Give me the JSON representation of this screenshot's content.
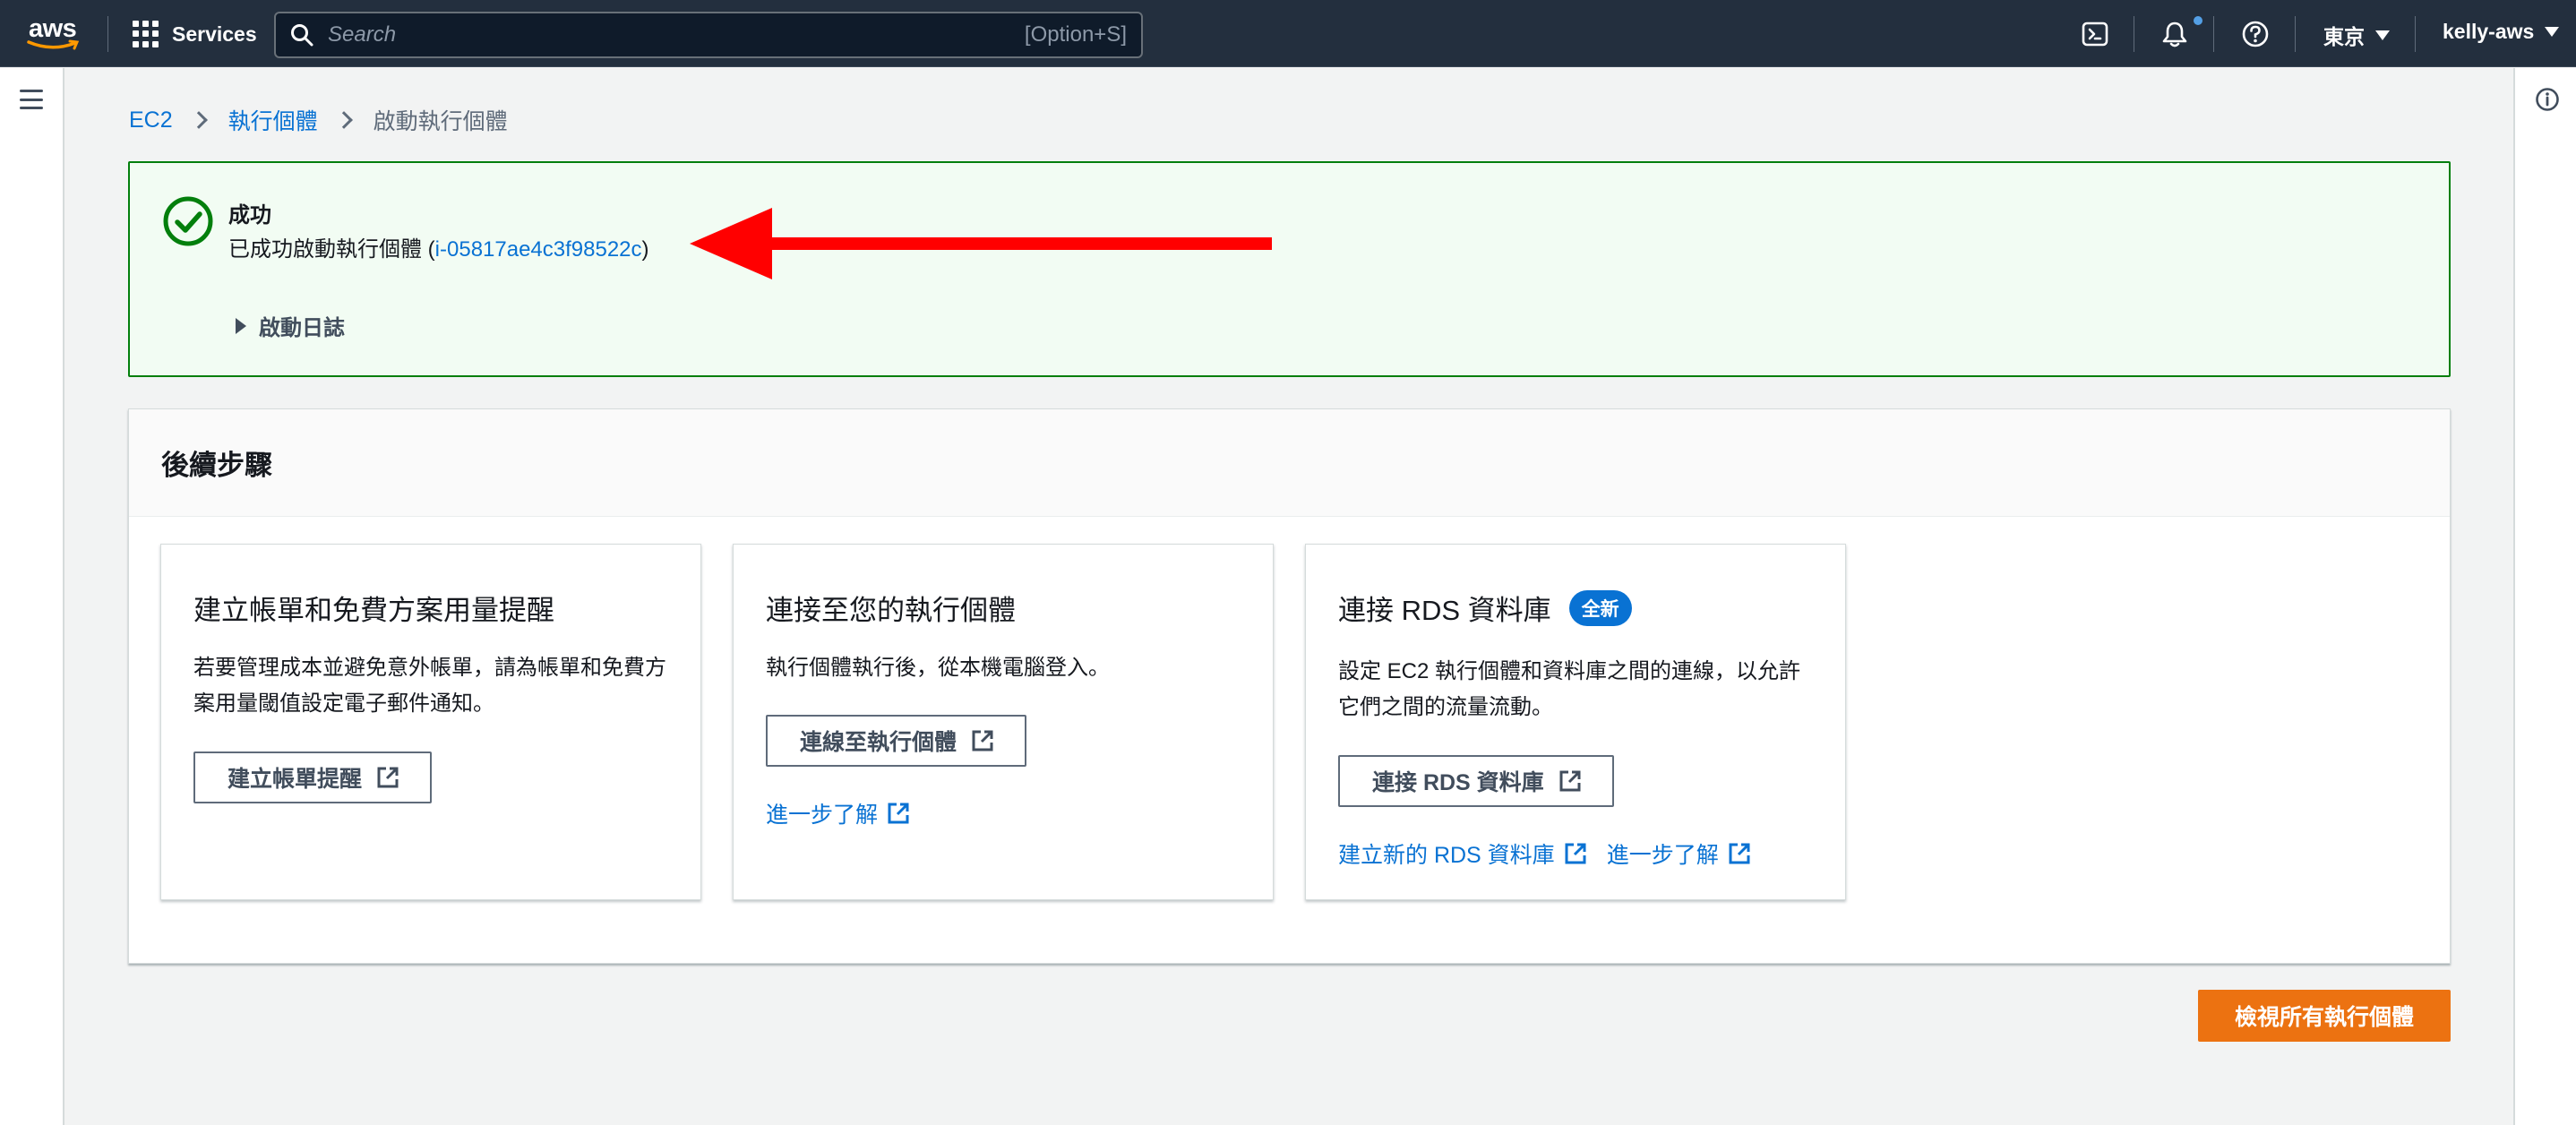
{
  "topnav": {
    "logo_text": "aws",
    "services_label": "Services",
    "search_placeholder": "Search",
    "search_shortcut": "[Option+S]",
    "region_label": "東京",
    "account_label": "kelly-aws",
    "icons": [
      "cloudshell-icon",
      "bell-icon",
      "help-icon"
    ]
  },
  "breadcrumb": {
    "items": [
      "EC2",
      "執行個體"
    ],
    "current": "啟動執行個體"
  },
  "alert": {
    "title": "成功",
    "message_prefix": "已成功啟動執行個體 (",
    "instance_id": "i-05817ae4c3f98522c",
    "message_suffix": ")",
    "log_label": "啟動日誌"
  },
  "next_steps": {
    "heading": "後續步驟",
    "cards": [
      {
        "title": "建立帳單和免費方案用量提醒",
        "description": "若要管理成本並避免意外帳單，請為帳單和免費方案用量閾值設定電子郵件通知。",
        "button_label": "建立帳單提醒"
      },
      {
        "title": "連接至您的執行個體",
        "description": "執行個體執行後，從本機電腦登入。",
        "button_label": "連線至執行個體",
        "links": [
          "進一步了解"
        ]
      },
      {
        "title": "連接 RDS 資料庫",
        "badge": "全新",
        "description": "設定 EC2 執行個體和資料庫之間的連線，以允許它們之間的流量流動。",
        "button_label": "連接 RDS 資料庫",
        "links": [
          "建立新的 RDS 資料庫",
          "進一步了解"
        ]
      }
    ]
  },
  "primary_button_label": "檢視所有執行個體",
  "colors": {
    "nav_bg": "#232f3e",
    "link": "#0972d3",
    "success": "#037f0c",
    "primary": "#ec7211",
    "annotation_arrow": "#ff0000"
  }
}
